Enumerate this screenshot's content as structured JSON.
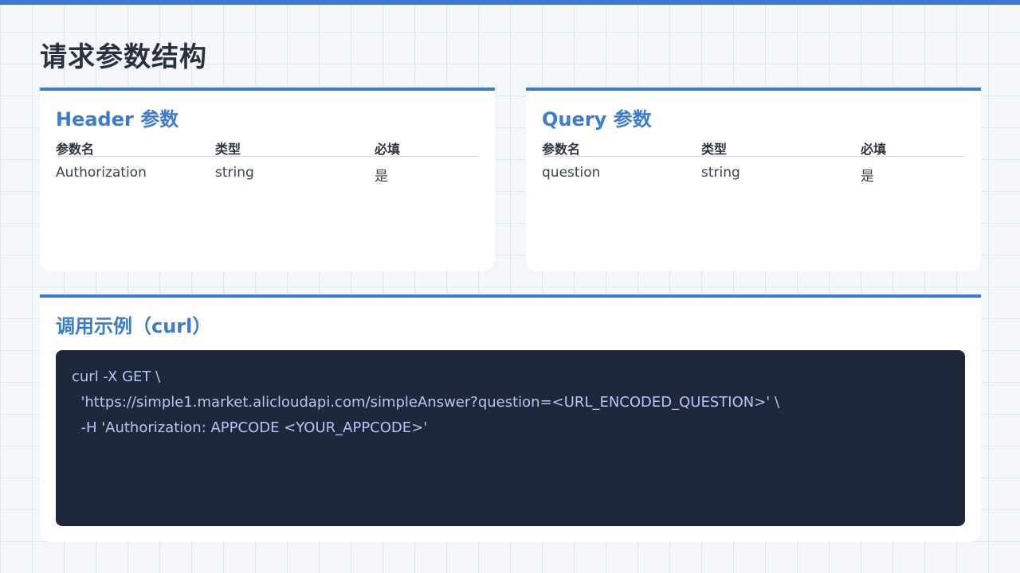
{
  "page": {
    "title": "请求参数结构",
    "accent_color": "#3b7bd0"
  },
  "header_params": {
    "title": "Header 参数",
    "columns": [
      "参数名",
      "类型",
      "必填"
    ],
    "rows": [
      {
        "name": "Authorization",
        "type": "string",
        "required": "是"
      }
    ]
  },
  "query_params": {
    "title": "Query 参数",
    "columns": [
      "参数名",
      "类型",
      "必填"
    ],
    "rows": [
      {
        "name": "question",
        "type": "string",
        "required": "是"
      }
    ]
  },
  "example": {
    "title": "调用示例（curl）",
    "code_lines": [
      "curl -X GET \\",
      "  'https://simple1.market.alicloudapi.com/simpleAnswer?question=<URL_ENCODED_QUESTION>' \\",
      "  -H 'Authorization: APPCODE <YOUR_APPCODE>'"
    ]
  }
}
